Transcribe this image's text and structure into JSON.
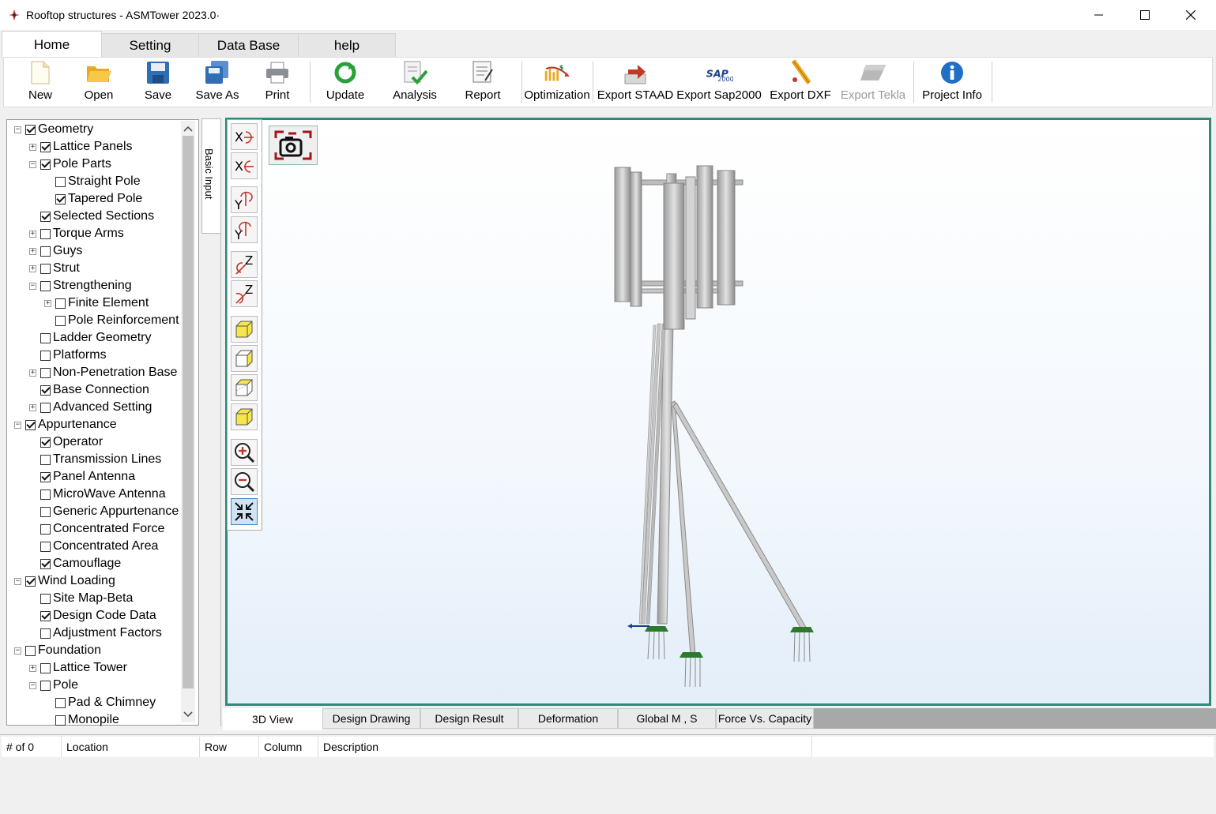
{
  "window": {
    "title": "Rooftop structures - ASMTower 2023.0·"
  },
  "tabs": [
    {
      "label": "Home",
      "active": true
    },
    {
      "label": "Setting",
      "active": false
    },
    {
      "label": "Data Base",
      "active": false
    },
    {
      "label": "help",
      "active": false
    }
  ],
  "ribbon": {
    "new": "New",
    "open": "Open",
    "save": "Save",
    "save_as": "Save As",
    "print": "Print",
    "update": "Update",
    "analysis": "Analysis",
    "report": "Report",
    "optimization": "Optimization",
    "export_staad": "Export STAAD",
    "export_sap2000": "Export Sap2000",
    "export_dxf": "Export DXF",
    "export_tekla": "Export Tekla",
    "project_info": "Project Info"
  },
  "tree": [
    {
      "label": "Geometry",
      "checked": true,
      "level": 0,
      "expander": "minus"
    },
    {
      "label": "Lattice Panels",
      "checked": true,
      "level": 1,
      "expander": "plus"
    },
    {
      "label": "Pole Parts",
      "checked": true,
      "level": 1,
      "expander": "minus"
    },
    {
      "label": "Straight Pole",
      "checked": false,
      "level": 2,
      "expander": ""
    },
    {
      "label": "Tapered Pole",
      "checked": true,
      "level": 2,
      "expander": ""
    },
    {
      "label": "Selected Sections",
      "checked": true,
      "level": 1,
      "expander": ""
    },
    {
      "label": "Torque Arms",
      "checked": false,
      "level": 1,
      "expander": "plus"
    },
    {
      "label": "Guys",
      "checked": false,
      "level": 1,
      "expander": "plus"
    },
    {
      "label": "Strut",
      "checked": false,
      "level": 1,
      "expander": "plus"
    },
    {
      "label": "Strengthening",
      "checked": false,
      "level": 1,
      "expander": "minus"
    },
    {
      "label": "Finite Element",
      "checked": false,
      "level": 2,
      "expander": "plus"
    },
    {
      "label": "Pole Reinforcement",
      "checked": false,
      "level": 2,
      "expander": ""
    },
    {
      "label": "Ladder Geometry",
      "checked": false,
      "level": 1,
      "expander": ""
    },
    {
      "label": "Platforms",
      "checked": false,
      "level": 1,
      "expander": ""
    },
    {
      "label": "Non-Penetration Base",
      "checked": false,
      "level": 1,
      "expander": "plus"
    },
    {
      "label": "Base Connection",
      "checked": true,
      "level": 1,
      "expander": ""
    },
    {
      "label": "Advanced Setting",
      "checked": false,
      "level": 1,
      "expander": "plus"
    },
    {
      "label": "Appurtenance",
      "checked": true,
      "level": 0,
      "expander": "minus"
    },
    {
      "label": "Operator",
      "checked": true,
      "level": 1,
      "expander": ""
    },
    {
      "label": "Transmission Lines",
      "checked": false,
      "level": 1,
      "expander": ""
    },
    {
      "label": "Panel Antenna",
      "checked": true,
      "level": 1,
      "expander": ""
    },
    {
      "label": "MicroWave Antenna",
      "checked": false,
      "level": 1,
      "expander": ""
    },
    {
      "label": "Generic Appurtenance",
      "checked": false,
      "level": 1,
      "expander": ""
    },
    {
      "label": "Concentrated Force",
      "checked": false,
      "level": 1,
      "expander": ""
    },
    {
      "label": "Concentrated Area",
      "checked": false,
      "level": 1,
      "expander": ""
    },
    {
      "label": "Camouflage",
      "checked": true,
      "level": 1,
      "expander": ""
    },
    {
      "label": "Wind Loading",
      "checked": true,
      "level": 0,
      "expander": "minus"
    },
    {
      "label": "Site Map-Beta",
      "checked": false,
      "level": 1,
      "expander": ""
    },
    {
      "label": "Design Code Data",
      "checked": true,
      "level": 1,
      "expander": ""
    },
    {
      "label": "Adjustment Factors",
      "checked": false,
      "level": 1,
      "expander": ""
    },
    {
      "label": "Foundation",
      "checked": false,
      "level": 0,
      "expander": "minus"
    },
    {
      "label": "Lattice Tower",
      "checked": false,
      "level": 1,
      "expander": "plus"
    },
    {
      "label": "Pole",
      "checked": false,
      "level": 1,
      "expander": "minus"
    },
    {
      "label": "Pad & Chimney",
      "checked": false,
      "level": 2,
      "expander": ""
    },
    {
      "label": "Monopile",
      "checked": false,
      "level": 2,
      "expander": ""
    }
  ],
  "side_tab": "Basic Input",
  "bottom_tabs": [
    {
      "label": "3D View",
      "active": true
    },
    {
      "label": "Design Drawing",
      "active": false
    },
    {
      "label": "Design Result",
      "active": false
    },
    {
      "label": "Deformation",
      "active": false
    },
    {
      "label": "Global M , S",
      "active": false
    },
    {
      "label": "Force Vs. Capacity",
      "active": false
    }
  ],
  "status_table": {
    "count": "# of 0",
    "columns": [
      "Location",
      "Row",
      "Column",
      "Description"
    ]
  },
  "colors": {
    "viewport_border": "#2e8b7a",
    "accent_blue": "#1f6fc5"
  }
}
